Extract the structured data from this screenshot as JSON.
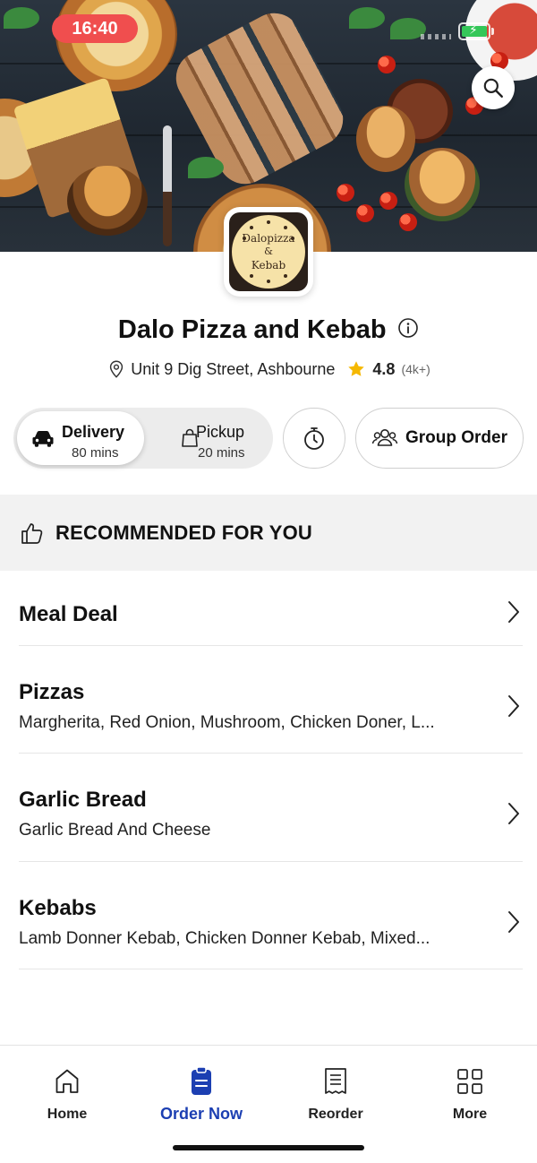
{
  "status_bar": {
    "time": "16:40"
  },
  "hero": {
    "search_icon": "search-icon"
  },
  "logo": {
    "line1": "Dalopizza",
    "line2": "&",
    "line3": "Kebab"
  },
  "restaurant": {
    "name": "Dalo Pizza and Kebab",
    "address": "Unit 9 Dig Street, Ashbourne",
    "rating": "4.8",
    "rating_count": "(4k+)"
  },
  "order_mode": {
    "delivery": {
      "label": "Delivery",
      "time": "80 mins",
      "selected": true
    },
    "pickup": {
      "label": "Pickup",
      "time": "20 mins",
      "selected": false
    },
    "group_order_label": "Group Order"
  },
  "recommended": {
    "label": "RECOMMENDED FOR YOU"
  },
  "categories": [
    {
      "name": "Meal Deal",
      "description": ""
    },
    {
      "name": "Pizzas",
      "description": "Margherita, Red Onion, Mushroom, Chicken Doner, L..."
    },
    {
      "name": "Garlic Bread",
      "description": "Garlic Bread And Cheese"
    },
    {
      "name": "Kebabs",
      "description": "Lamb Donner Kebab, Chicken Donner Kebab, Mixed..."
    }
  ],
  "bottom_nav": [
    {
      "label": "Home",
      "icon": "home-icon",
      "active": false
    },
    {
      "label": "Order Now",
      "icon": "order-now-icon",
      "active": true
    },
    {
      "label": "Reorder",
      "icon": "receipt-icon",
      "active": false
    },
    {
      "label": "More",
      "icon": "grid-icon",
      "active": false
    }
  ],
  "colors": {
    "accent": "#1c3fb2",
    "time_pill": "#f04e4e",
    "star": "#f5b800",
    "battery": "#34c759"
  }
}
